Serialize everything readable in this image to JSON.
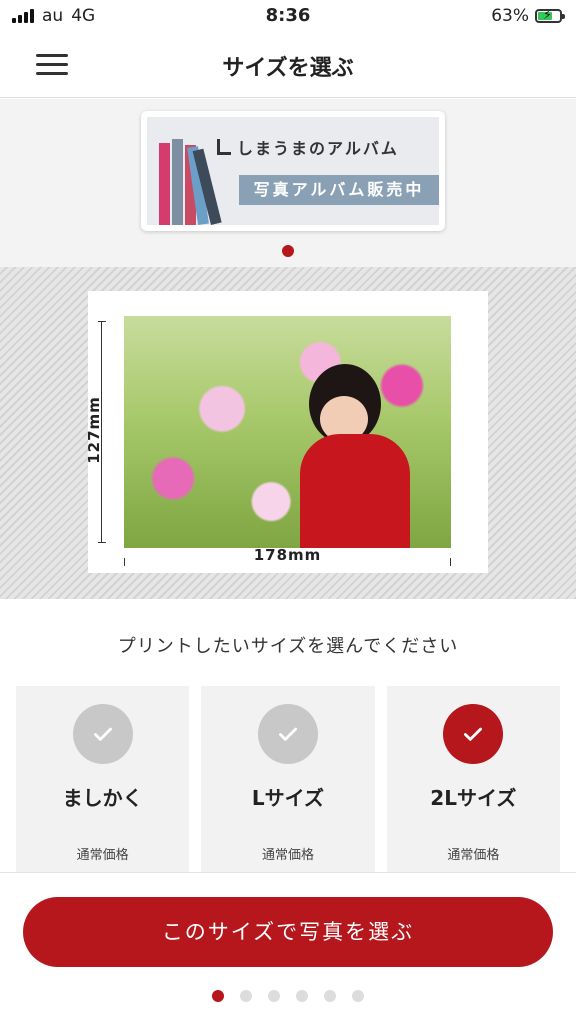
{
  "status_bar": {
    "carrier": "au",
    "network": "4G",
    "time": "8:36",
    "battery": "63%"
  },
  "nav": {
    "title": "サイズを選ぶ",
    "menu_icon": "hamburger-menu-icon"
  },
  "banner": {
    "brand": "しまうまのアルバム",
    "tag": "写真アルバム販売中"
  },
  "preview": {
    "height_label": "127mm",
    "width_label": "178mm"
  },
  "prompt": "プリントしたいサイズを選んでください",
  "sizes": [
    {
      "name": "ましかく",
      "price_label": "通常価格",
      "selected": false
    },
    {
      "name": "Lサイズ",
      "price_label": "通常価格",
      "selected": false
    },
    {
      "name": "2Lサイズ",
      "price_label": "通常価格",
      "selected": true
    }
  ],
  "cta": "このサイズで写真を選ぶ",
  "colors": {
    "accent": "#b5171c",
    "unselected": "#c8c8c8"
  }
}
